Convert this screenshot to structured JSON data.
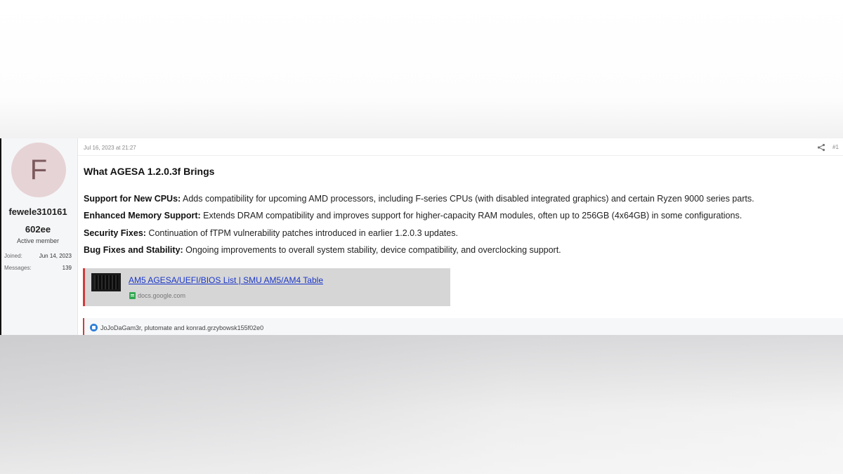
{
  "user": {
    "avatar_letter": "F",
    "name_line1": "fewele310161",
    "name_line2": "602ee",
    "title": "Active member",
    "joined_label": "Joined:",
    "joined_value": "Jun 14, 2023",
    "messages_label": "Messages:",
    "messages_value": "139"
  },
  "post": {
    "date": "Jul 16, 2023 at 21:27",
    "number": "#1",
    "heading": "What AGESA 1.2.0.3f Brings",
    "bullets": [
      {
        "label": "Support for New CPUs:",
        "text": " Adds compatibility for upcoming AMD processors, including F-series CPUs (with disabled integrated graphics) and certain Ryzen 9000 series parts."
      },
      {
        "label": "Enhanced Memory Support:",
        "text": " Extends DRAM compatibility and improves support for higher-capacity RAM modules, often up to 256GB (4x64GB) in some configurations."
      },
      {
        "label": "Security Fixes:",
        "text": " Continuation of fTPM vulnerability patches introduced in earlier 1.2.0.3 updates."
      },
      {
        "label": "Bug Fixes and Stability:",
        "text": " Ongoing improvements to overall system stability, device compatibility, and overclocking support."
      }
    ],
    "embed": {
      "title": "AM5 AGESA/UEFI/BIOS List | SMU AM5/AM4 Table",
      "domain": "docs.google.com"
    },
    "reactions": "JoJoDaGam3r, plutomate and konrad.grzybowsk155f02e0"
  },
  "colors": {
    "accent_red": "#d23b3b",
    "link_blue": "#1a36c8",
    "avatar_bg": "#e6d3d5"
  }
}
